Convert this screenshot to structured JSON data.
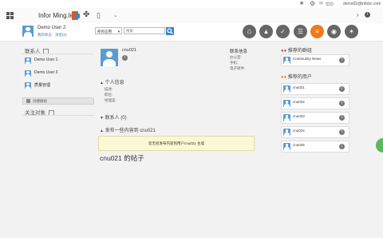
{
  "topbar": {
    "user_email": "demo02@infobc.com"
  },
  "appbar": {
    "brand": "Infor Ming.le"
  },
  "profile": {
    "name": "Demo User 2",
    "status_label": "我的状态",
    "stat_label": "消息(0)",
    "search_scope": "所有应用",
    "search_placeholder": "搜索"
  },
  "left": {
    "contacts_header": "联系人",
    "contacts": [
      {
        "name": "Demo User 1"
      },
      {
        "name": "Demo User 3"
      },
      {
        "name": "质量管理"
      }
    ],
    "create_group": "创建群组",
    "follow_header": "关注对象"
  },
  "center": {
    "username": "cnu021",
    "contact_info_header": "联系信息",
    "contact_info_fields": [
      "办公室:",
      "手机:",
      "电子邮件:"
    ],
    "personal_header": "个人信息",
    "personal_fields": [
      "描述:",
      "职位:",
      "经理是:"
    ],
    "contacts_section": "联系人 (0)",
    "share_header": "发布一些内容到 cnu021",
    "notice": "您无权发布内容到用户cnu021 主墙",
    "posts_title": "cnu021 的帖子"
  },
  "right": {
    "groups_header": "推荐的群组",
    "groups": [
      {
        "name": "Community News"
      }
    ],
    "users_header": "推荐的用户",
    "users": [
      {
        "name": "cnu021"
      },
      {
        "name": "cnu022"
      },
      {
        "name": "cnu023"
      },
      {
        "name": "cnu024"
      },
      {
        "name": "cnu025"
      }
    ]
  },
  "colors": {
    "accent": "#ef7a1a",
    "link": "#3a7bc8",
    "notice_bg": "#fcf8d5",
    "avatar": "#5b9bd5"
  }
}
